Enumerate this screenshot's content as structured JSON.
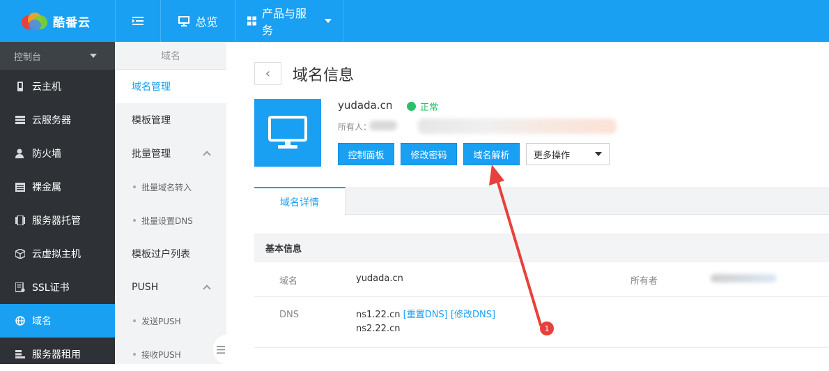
{
  "app": {
    "logo_text": "酷番云"
  },
  "topnav": {
    "overview": "总览",
    "products": "产品与服务"
  },
  "sidebar": {
    "console": "控制台",
    "items": [
      {
        "label": "云主机",
        "icon": "phone-icon"
      },
      {
        "label": "云服务器",
        "icon": "server-icon"
      },
      {
        "label": "防火墙",
        "icon": "user-shield-icon"
      },
      {
        "label": "裸金属",
        "icon": "grid-icon"
      },
      {
        "label": "服务器托管",
        "icon": "rack-icon"
      },
      {
        "label": "云虚拟主机",
        "icon": "cube-icon"
      },
      {
        "label": "SSL证书",
        "icon": "certificate-icon"
      },
      {
        "label": "域名",
        "icon": "globe-icon",
        "active": true
      },
      {
        "label": "服务器租用",
        "icon": "server-rent-icon"
      }
    ]
  },
  "subside": {
    "title": "域名",
    "domain_manage": "域名管理",
    "template_manage": "模板管理",
    "batch_manage": "批量管理",
    "batch_transfer": "批量域名转入",
    "batch_dns": "批量设置DNS",
    "template_transfer": "模板过户列表",
    "push": "PUSH",
    "send_push": "发送PUSH",
    "receive_push": "接收PUSH"
  },
  "main": {
    "title": "域名信息",
    "domain": "yudada.cn",
    "status": "正常",
    "owner_label": "所有人：",
    "buttons": {
      "control_panel": "控制面板",
      "change_password": "修改密码",
      "dns_resolve": "域名解析",
      "more": "更多操作"
    },
    "tab_detail": "域名详情",
    "basic_info": "基本信息",
    "rows": {
      "domain_key": "域名",
      "domain_val": "yudada.cn",
      "owner_key": "所有者",
      "dns_key": "DNS",
      "dns1": "ns1.22.cn",
      "reset_dns": "[重置DNS]",
      "modify_dns": "[修改DNS]",
      "dns2": "ns2.22.cn"
    },
    "annotation_number": "1"
  },
  "colors": {
    "brand": "#1aa0f3",
    "sidebar_dark": "#2e3236",
    "status_green": "#2cbf6a",
    "annotation_red": "#e8403a"
  }
}
